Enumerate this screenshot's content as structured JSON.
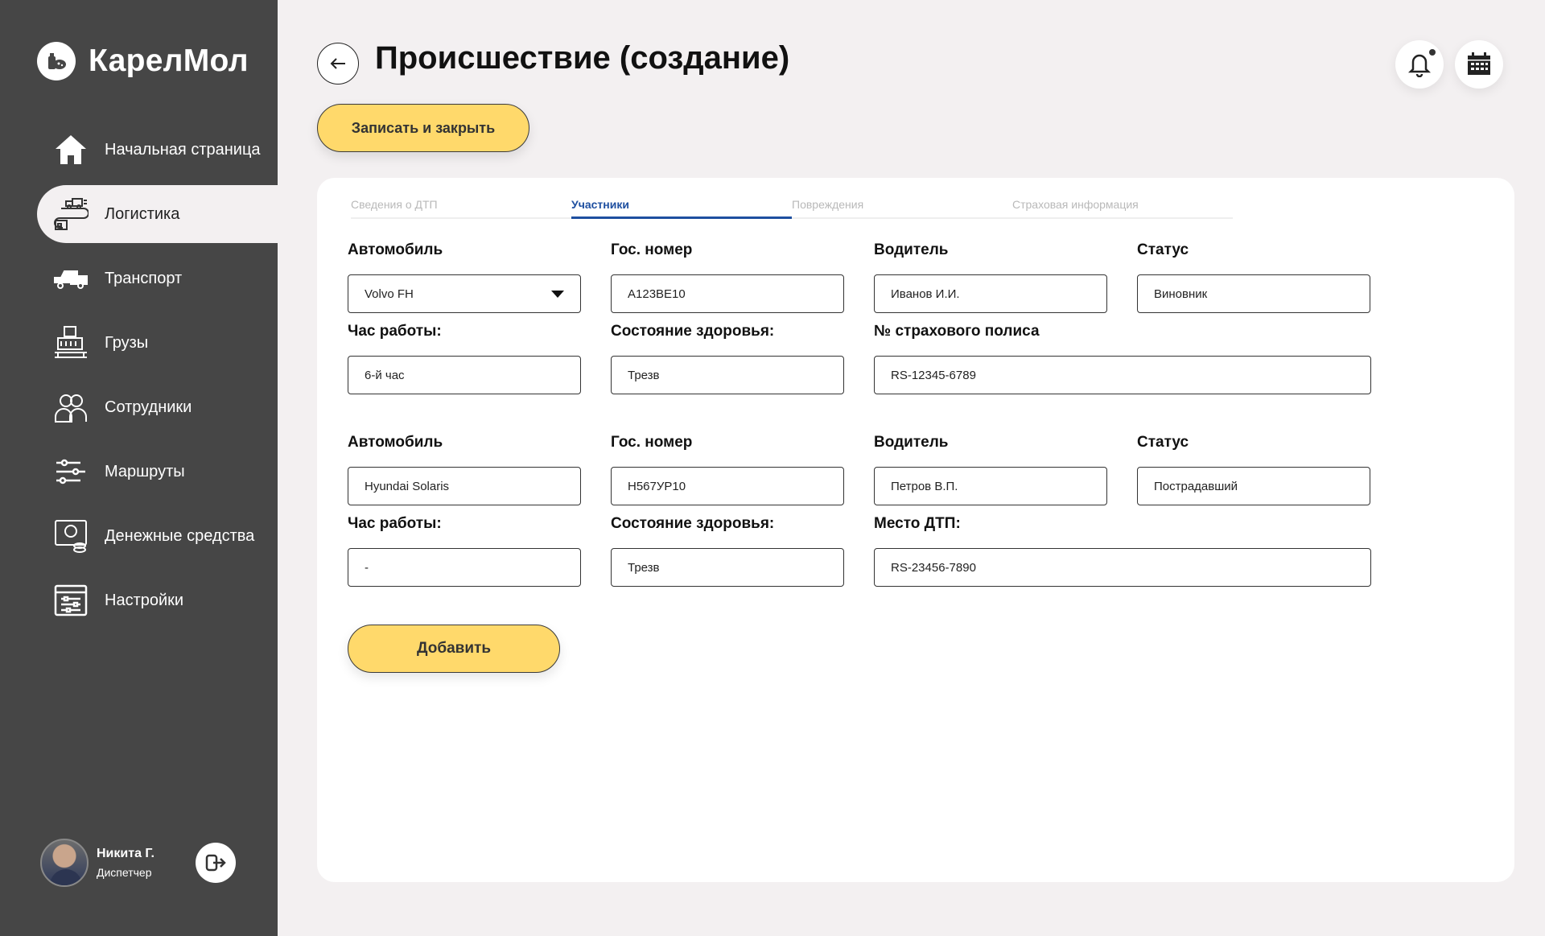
{
  "app": {
    "name": "КарелМол"
  },
  "sidebar": {
    "items": [
      {
        "label": "Начальная страница",
        "icon": "home-icon"
      },
      {
        "label": "Логистика",
        "icon": "logistics-icon",
        "active": true
      },
      {
        "label": "Транспорт",
        "icon": "transport-icon"
      },
      {
        "label": "Грузы",
        "icon": "cargo-icon"
      },
      {
        "label": "Сотрудники",
        "icon": "employees-icon"
      },
      {
        "label": "Маршруты",
        "icon": "routes-icon"
      },
      {
        "label": "Денежные средства",
        "icon": "money-icon"
      },
      {
        "label": "Настройки",
        "icon": "settings-icon"
      }
    ],
    "user": {
      "name": "Никита Г.",
      "role": "Диспетчер"
    }
  },
  "header": {
    "title": "Происшествие (создание)",
    "save_close_label": "Записать и закрыть"
  },
  "tabs": [
    {
      "label": "Сведения о ДТП"
    },
    {
      "label": "Участники",
      "active": true
    },
    {
      "label": "Повреждения"
    },
    {
      "label": "Страховая информация"
    }
  ],
  "participants": [
    {
      "car_label": "Автомобиль",
      "car": "Volvo FH",
      "plate_label": "Гос. номер",
      "plate": "А123ВЕ10",
      "driver_label": "Водитель",
      "driver": "Иванов И.И.",
      "status_label": "Статус",
      "status": "Виновник",
      "hours_label": "Час работы:",
      "hours": "6-й час",
      "health_label": "Состояние здоровья:",
      "health": "Трезв",
      "extra_label": "№ страхового полиса",
      "extra": "RS-12345-6789"
    },
    {
      "car_label": "Автомобиль",
      "car": "Hyundai Solaris",
      "plate_label": "Гос. номер",
      "plate": "Н567УР10",
      "driver_label": "Водитель",
      "driver": "Петров В.П.",
      "status_label": "Статус",
      "status": "Пострадавший",
      "hours_label": "Час работы:",
      "hours": "-",
      "health_label": "Состояние здоровья:",
      "health": "Трезв",
      "extra_label": "Место ДТП:",
      "extra": "RS-23456-7890"
    }
  ],
  "add_label": "Добавить",
  "colors": {
    "sidebar": "#464646",
    "accent": "#ffd96b",
    "tab_active": "#1e4fa0",
    "background": "#f3f0f1"
  }
}
